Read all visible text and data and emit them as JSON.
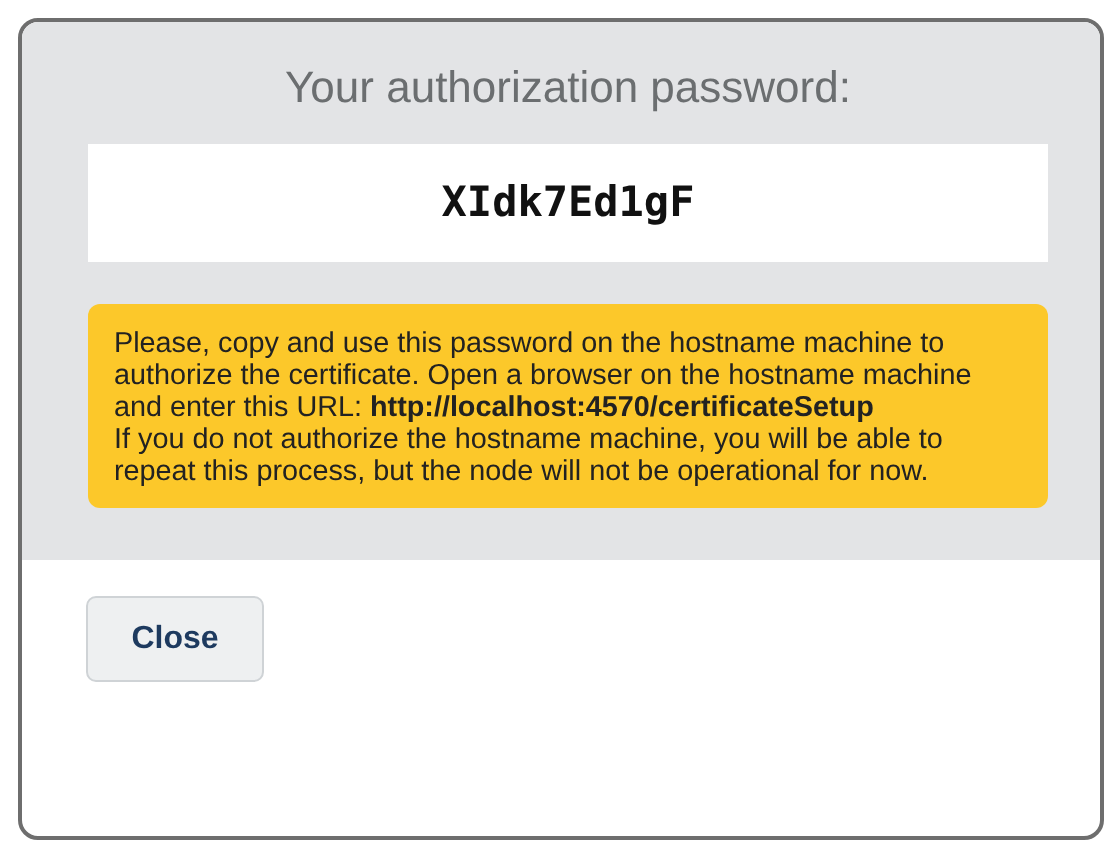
{
  "dialog": {
    "title": "Your authorization password:",
    "password": "XIdk7Ed1gF",
    "notice": [
      "Please, copy and use this password on the hostname machine to authorize the certificate. Open a browser on the hostname machine and enter this URL: **http://localhost:4570/certificateSetup**",
      "If you do not authorize the hostname machine, you will be able to repeat this process, but the node will not be operational for now."
    ],
    "buttons": [
      {
        "label": "Close"
      }
    ]
  }
}
